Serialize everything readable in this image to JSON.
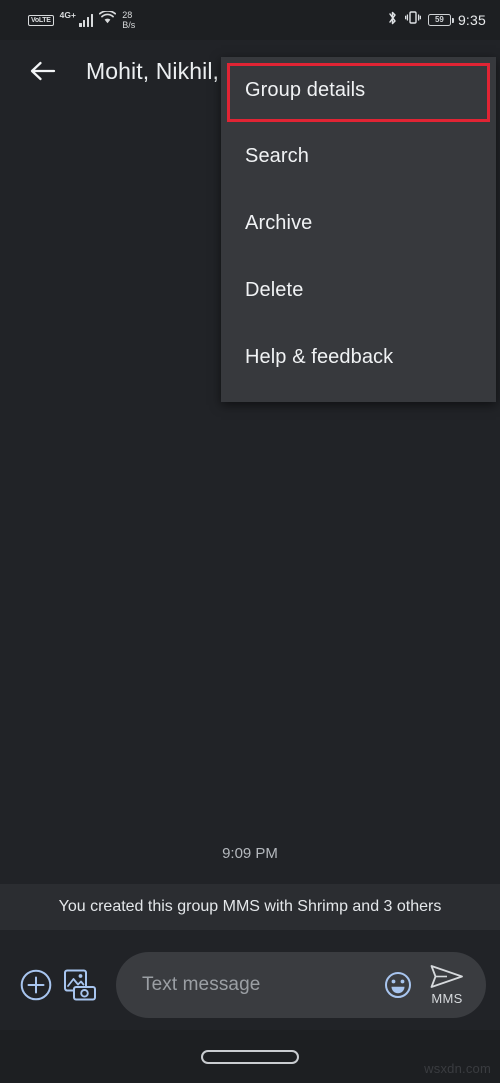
{
  "status_bar": {
    "volte_label": "VoLTE",
    "network_label": "4G+",
    "data_rate_value": "28",
    "data_rate_unit": "B/s",
    "bluetooth_icon": "bluetooth-icon",
    "vibrate_icon": "vibrate-icon",
    "battery_percent": "59",
    "time": "9:35"
  },
  "app_bar": {
    "back_icon": "back-arrow-icon",
    "conversation_title": "Mohit, Nikhil,"
  },
  "overflow_menu": {
    "items": [
      {
        "label": "Group details",
        "highlighted": true
      },
      {
        "label": "Search",
        "highlighted": false
      },
      {
        "label": "Archive",
        "highlighted": false
      },
      {
        "label": "Delete",
        "highlighted": false
      },
      {
        "label": "Help & feedback",
        "highlighted": false
      }
    ],
    "highlight_color": "#e02434",
    "background_color": "#37393d"
  },
  "conversation": {
    "timestamp": "9:09 PM",
    "system_message": "You created this group MMS with Shrimp  and 3 others"
  },
  "composer": {
    "attach_icon": "plus-circle-icon",
    "gallery_icon": "gallery-camera-icon",
    "input_placeholder": "Text message",
    "input_value": "",
    "emoji_icon": "emoji-smiley-icon",
    "send_icon": "send-arrow-icon",
    "send_label": "MMS",
    "accent_color": "#a8c5ef"
  },
  "nav_bar": {
    "home_indicator": "home-gesture-pill"
  },
  "watermark": {
    "text": "wsxdn.com"
  }
}
